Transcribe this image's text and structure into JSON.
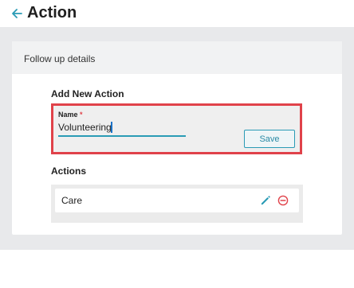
{
  "header": {
    "title": "Action"
  },
  "card": {
    "header_title": "Follow up details",
    "add_section_title": "Add New Action",
    "form": {
      "name_label": "Name",
      "required_mark": "*",
      "name_value": "Volunteering",
      "save_label": "Save"
    },
    "actions_section_title": "Actions",
    "actions": [
      {
        "label": "Care"
      }
    ]
  },
  "colors": {
    "accent": "#2a9bb5",
    "highlight_border": "#e0424a",
    "remove": "#e0424a",
    "band": "#e8e9eb"
  },
  "icons": {
    "back": "arrow-left-icon",
    "edit": "pencil-icon",
    "remove": "minus-circle-icon"
  }
}
